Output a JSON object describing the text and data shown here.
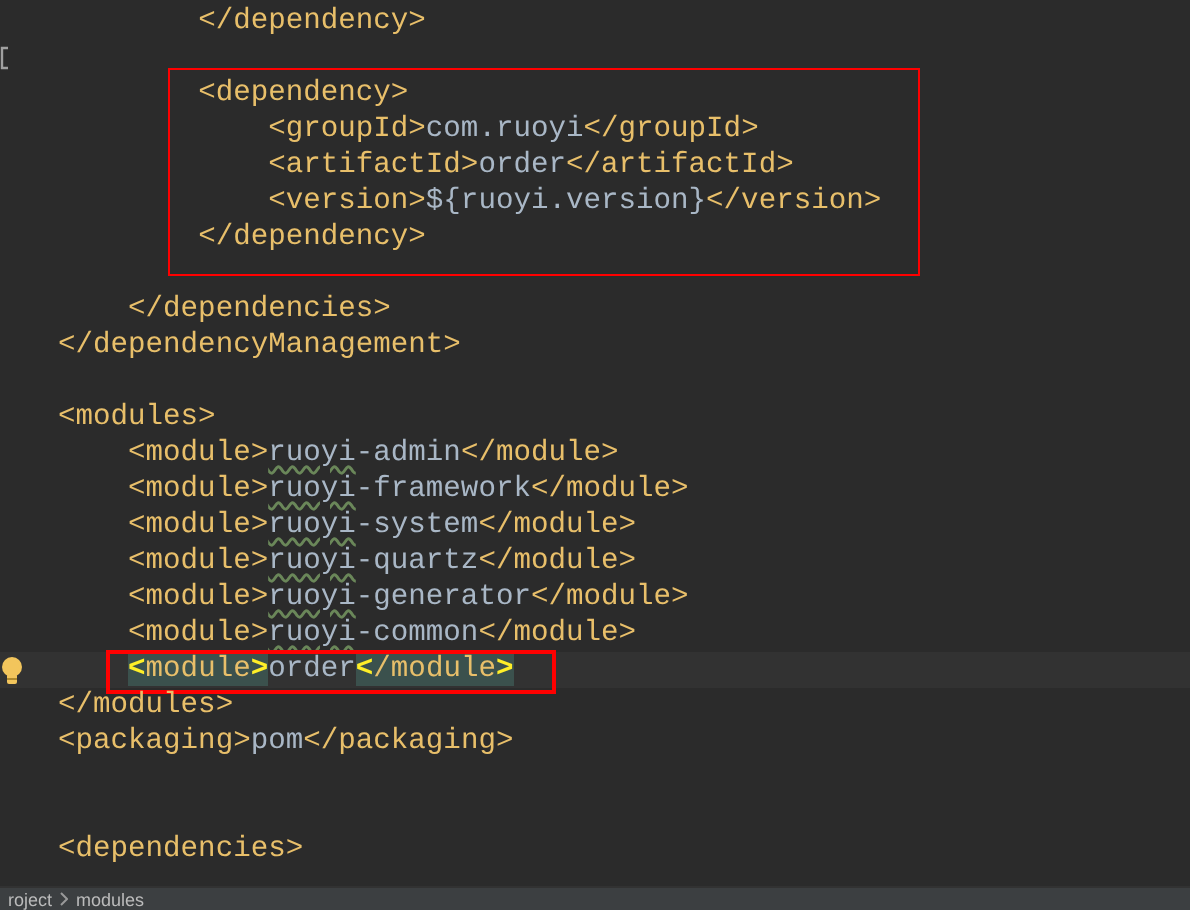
{
  "editor": {
    "lines": [
      {
        "tokens": [
          {
            "kind": "tag",
            "text": "        </dependency>"
          }
        ]
      },
      {
        "fold_marker": true
      },
      {
        "boxed": true,
        "tokens": [
          {
            "kind": "tag",
            "text": "        <dependency>"
          }
        ]
      },
      {
        "boxed": true,
        "tokens": [
          {
            "kind": "tag",
            "text": "            <groupId>"
          },
          {
            "kind": "text",
            "text": "com.ruoyi"
          },
          {
            "kind": "tag",
            "text": "</groupId>"
          }
        ]
      },
      {
        "boxed": true,
        "tokens": [
          {
            "kind": "tag",
            "text": "            <artifactId>"
          },
          {
            "kind": "text",
            "text": "order"
          },
          {
            "kind": "tag",
            "text": "</artifactId>"
          }
        ]
      },
      {
        "boxed": true,
        "tokens": [
          {
            "kind": "tag",
            "text": "            <version>"
          },
          {
            "kind": "text",
            "text": "${ruoyi.version}"
          },
          {
            "kind": "tag",
            "text": "</version>"
          }
        ]
      },
      {
        "boxed": true,
        "blank_line_after": true,
        "tokens": [
          {
            "kind": "tag",
            "text": "        </dependency>"
          }
        ]
      },
      {
        "tokens": [
          {
            "kind": "tag",
            "text": "    </dependencies>"
          }
        ]
      },
      {
        "blank_line_after": true,
        "tokens": [
          {
            "kind": "tag",
            "text": "</dependencyManagement>"
          }
        ]
      },
      {
        "tokens": [
          {
            "kind": "tag",
            "text": "<modules>"
          }
        ]
      },
      {
        "tokens": [
          {
            "kind": "tag",
            "text": "    <module>"
          },
          {
            "kind": "text",
            "text": "ruoyi",
            "typo": true
          },
          {
            "kind": "text",
            "text": "-admin"
          },
          {
            "kind": "tag",
            "text": "</module>"
          }
        ]
      },
      {
        "tokens": [
          {
            "kind": "tag",
            "text": "    <module>"
          },
          {
            "kind": "text",
            "text": "ruoyi",
            "typo": true
          },
          {
            "kind": "text",
            "text": "-framework"
          },
          {
            "kind": "tag",
            "text": "</module>"
          }
        ]
      },
      {
        "tokens": [
          {
            "kind": "tag",
            "text": "    <module>"
          },
          {
            "kind": "text",
            "text": "ruoyi",
            "typo": true
          },
          {
            "kind": "text",
            "text": "-system"
          },
          {
            "kind": "tag",
            "text": "</module>"
          }
        ]
      },
      {
        "tokens": [
          {
            "kind": "tag",
            "text": "    <module>"
          },
          {
            "kind": "text",
            "text": "ruoyi",
            "typo": true
          },
          {
            "kind": "text",
            "text": "-quartz"
          },
          {
            "kind": "tag",
            "text": "</module>"
          }
        ]
      },
      {
        "tokens": [
          {
            "kind": "tag",
            "text": "    <module>"
          },
          {
            "kind": "text",
            "text": "ruoyi",
            "typo": true
          },
          {
            "kind": "text",
            "text": "-generator"
          },
          {
            "kind": "tag",
            "text": "</module>"
          }
        ]
      },
      {
        "tokens": [
          {
            "kind": "tag",
            "text": "    <module>"
          },
          {
            "kind": "text",
            "text": "ruoyi",
            "typo": true
          },
          {
            "kind": "text",
            "text": "-common"
          },
          {
            "kind": "tag",
            "text": "</module>"
          }
        ]
      },
      {
        "current": true,
        "boxed": true,
        "intention_bulb": true,
        "tokens": [
          {
            "kind": "tag",
            "text": "    <module>",
            "matched": true
          },
          {
            "kind": "text",
            "text": "order"
          },
          {
            "kind": "tag",
            "text": "</module>",
            "matched": true
          }
        ]
      },
      {
        "tokens": [
          {
            "kind": "tag",
            "text": "</modules>"
          }
        ]
      },
      {
        "blank_line_after": true,
        "tokens": [
          {
            "kind": "tag",
            "text": "<packaging>"
          },
          {
            "kind": "text",
            "text": "pom"
          },
          {
            "kind": "tag",
            "text": "</packaging>"
          }
        ]
      },
      {
        "blank_line_before": true,
        "tokens": [
          {
            "kind": "tag",
            "text": "<dependencies>"
          }
        ]
      }
    ]
  },
  "breadcrumbs": [
    "roject",
    "modules"
  ]
}
